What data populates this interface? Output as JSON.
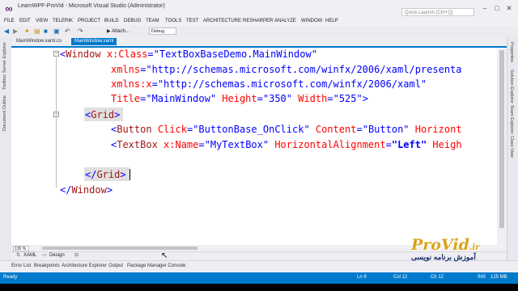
{
  "window": {
    "title": "LearnWPF-ProVid - Microsoft Visual Studio (Administrator)",
    "quick_launch_placeholder": "Quick Launch (Ctrl+Q)",
    "controls": [
      "–",
      "□",
      "✕"
    ]
  },
  "menu": [
    "FILE",
    "EDIT",
    "VIEW",
    "TELERIK",
    "PROJECT",
    "BUILD",
    "DEBUG",
    "TEAM",
    "TOOLS",
    "TEST",
    "ARCHITECTURE",
    "RESHARPER",
    "ANALYZE",
    "WINDOW",
    "HELP"
  ],
  "toolbar": {
    "attach_label": "▶ Attach...",
    "config_value": "Debug",
    "icons": [
      "back-icon",
      "forward-icon",
      "new-project-icon",
      "open-icon",
      "save-icon",
      "save-all-icon",
      "undo-icon",
      "redo-icon"
    ]
  },
  "tabs": [
    {
      "label": "MainWindow.xaml.cs",
      "active": false
    },
    {
      "label": "MainWindow.xaml",
      "active": true,
      "close": "✕"
    }
  ],
  "left_rail": [
    "Server Explorer",
    "Toolbox",
    "Document Outline"
  ],
  "right_rail": [
    "Properties",
    "Solution Explorer",
    "Team Explorer",
    "Class View"
  ],
  "code": {
    "l1": {
      "open": "<",
      "tag": "Window",
      "attr": " x:Class",
      "eq": "=",
      "val": "\"TextBoxBaseDemo.MainWindow\""
    },
    "l2": {
      "attr": "xmlns",
      "eq": "=",
      "val": "\"http://schemas.microsoft.com/winfx/2006/xaml/presenta"
    },
    "l3": {
      "attr": "xmlns:x",
      "eq": "=",
      "val": "\"http://schemas.microsoft.com/winfx/2006/xaml\""
    },
    "l4": {
      "a1": "Title",
      "v1": "\"MainWindow\"",
      "a2": " Height",
      "v2": "\"350\"",
      "a3": " Width",
      "v3": "\"525\"",
      "close": ">",
      "eq": "="
    },
    "l5": {
      "open": "<",
      "tag": "Grid",
      "close": ">"
    },
    "l6": {
      "open": "<",
      "tag": "Button",
      "a1": " Click",
      "v1": "\"ButtonBase_OnClick\"",
      "a2": " Content",
      "v2": "\"Button\"",
      "a3": " Horizont",
      "eq": "="
    },
    "l7": {
      "open": "<",
      "tag": "TextBox",
      "a1": " x:Name",
      "v1": "\"MyTextBox\"",
      "a2": " HorizontalAlignment",
      "v2": "\"Left\"",
      "a3": " Heigh",
      "eq": "="
    },
    "l8": {
      "open": "</",
      "tag": "Grid",
      "close": ">"
    },
    "l9": {
      "open": "</",
      "tag": "Window",
      "close": ">"
    }
  },
  "editor": {
    "zoom": "136 %",
    "collapse_glyph": "−",
    "views": [
      {
        "label": "XAML",
        "icon": "swap-icon"
      },
      {
        "label": "Design",
        "icon": "design-icon"
      }
    ]
  },
  "bottom_tabs": [
    "Error List",
    "Breakpoints",
    "Architecture Explorer",
    "Output",
    "Package Manager Console"
  ],
  "status": {
    "state": "Ready",
    "line": "Ln 9",
    "col": "Col 12",
    "ch": "Ch 12",
    "mode": "INS",
    "memory": "125 MB"
  },
  "logo": {
    "text": "ProVid",
    "suffix": ".ir",
    "subtitle": "آموزش برنامه نویسی"
  },
  "colors": {
    "accent": "#007acc",
    "tag": "#a31515",
    "attribute": "#ff0000",
    "value": "#0000ff",
    "logo": "#d9a21b"
  }
}
